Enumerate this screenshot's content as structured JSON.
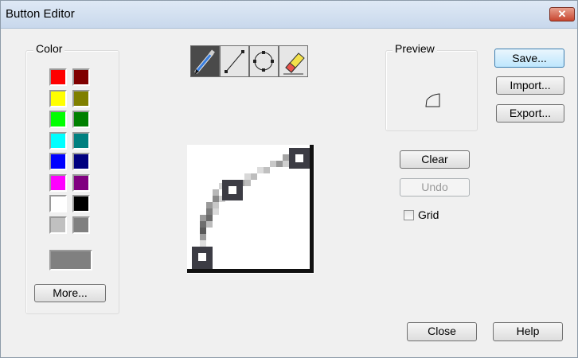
{
  "window": {
    "title": "Button Editor"
  },
  "color_group": {
    "label": "Color",
    "swatches": [
      [
        "#ff0000",
        "#800000"
      ],
      [
        "#ffff00",
        "#808000"
      ],
      [
        "#00ff00",
        "#008000"
      ],
      [
        "#00ffff",
        "#008080"
      ],
      [
        "#0000ff",
        "#000080"
      ],
      [
        "#ff00ff",
        "#800080"
      ],
      [
        "#ffffff",
        "#000000"
      ],
      [
        "#c0c0c0",
        "#808080"
      ]
    ],
    "current_color": "#808080",
    "more_label": "More..."
  },
  "tools": [
    {
      "icon": "pencil-tool-icon",
      "active": true
    },
    {
      "icon": "line-tool-icon",
      "active": false
    },
    {
      "icon": "ellipse-tool-icon",
      "active": false
    },
    {
      "icon": "eraser-tool-icon",
      "active": false
    }
  ],
  "preview": {
    "label": "Preview"
  },
  "buttons": {
    "save": "Save...",
    "import": "Import...",
    "export": "Export...",
    "clear": "Clear",
    "undo": "Undo",
    "close": "Close",
    "help": "Help"
  },
  "grid": {
    "label": "Grid",
    "checked": false
  }
}
